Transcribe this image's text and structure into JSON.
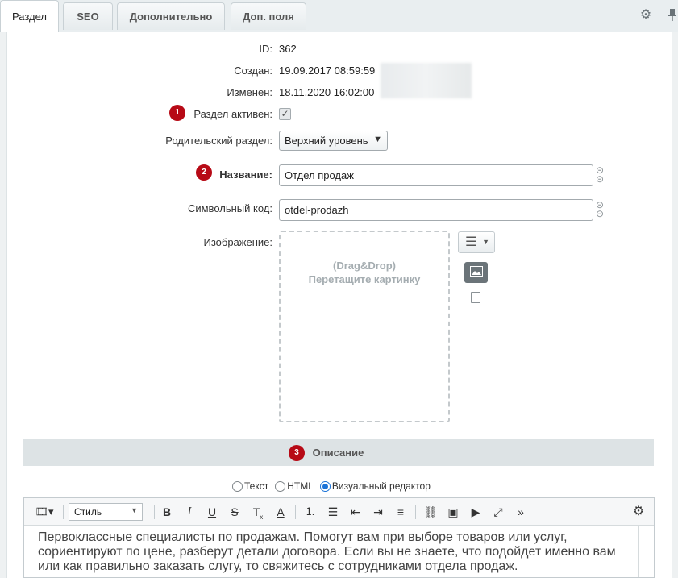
{
  "tabs": [
    {
      "label": "Раздел"
    },
    {
      "label": "SEO"
    },
    {
      "label": "Дополнительно"
    },
    {
      "label": "Доп. поля"
    }
  ],
  "tab_icons": [
    "gear-icon",
    "pin-icon"
  ],
  "fields": {
    "id": {
      "label": "ID:",
      "value": "362"
    },
    "created": {
      "label": "Создан:",
      "value": "19.09.2017 08:59:59"
    },
    "modified": {
      "label": "Изменен:",
      "value": "18.11.2020 16:02:00"
    },
    "active": {
      "label": "Раздел активен:",
      "checked": true
    },
    "parent": {
      "label": "Родительский раздел:",
      "value": "Верхний уровень"
    },
    "name": {
      "label": "Название:",
      "value": "Отдел продаж"
    },
    "code": {
      "label": "Символьный код:",
      "value": "otdel-prodazh"
    },
    "image": {
      "label": "Изображение:",
      "drop_line1": "(Drag&Drop)",
      "drop_line2": "Перетащите картинку"
    }
  },
  "badges": [
    "1",
    "2",
    "3"
  ],
  "description": {
    "title": "Описание",
    "modes": [
      {
        "label": "Текст",
        "selected": false
      },
      {
        "label": "HTML",
        "selected": false
      },
      {
        "label": "Визуальный редактор",
        "selected": true
      }
    ],
    "style_select": "Стиль",
    "text": "Первоклассные специалисты по продажам. Помогут вам при выборе товаров или услуг, сориентируют по цене, разберут детали договора. Если вы не знаете, что подойдет именно вам или как правильно заказать слугу, то свяжитесь с сотрудниками отдела продаж."
  },
  "colors": {
    "badge": "#b70a16",
    "radio_selected": "#1a73d8",
    "section_bg": "#dde3e5"
  }
}
